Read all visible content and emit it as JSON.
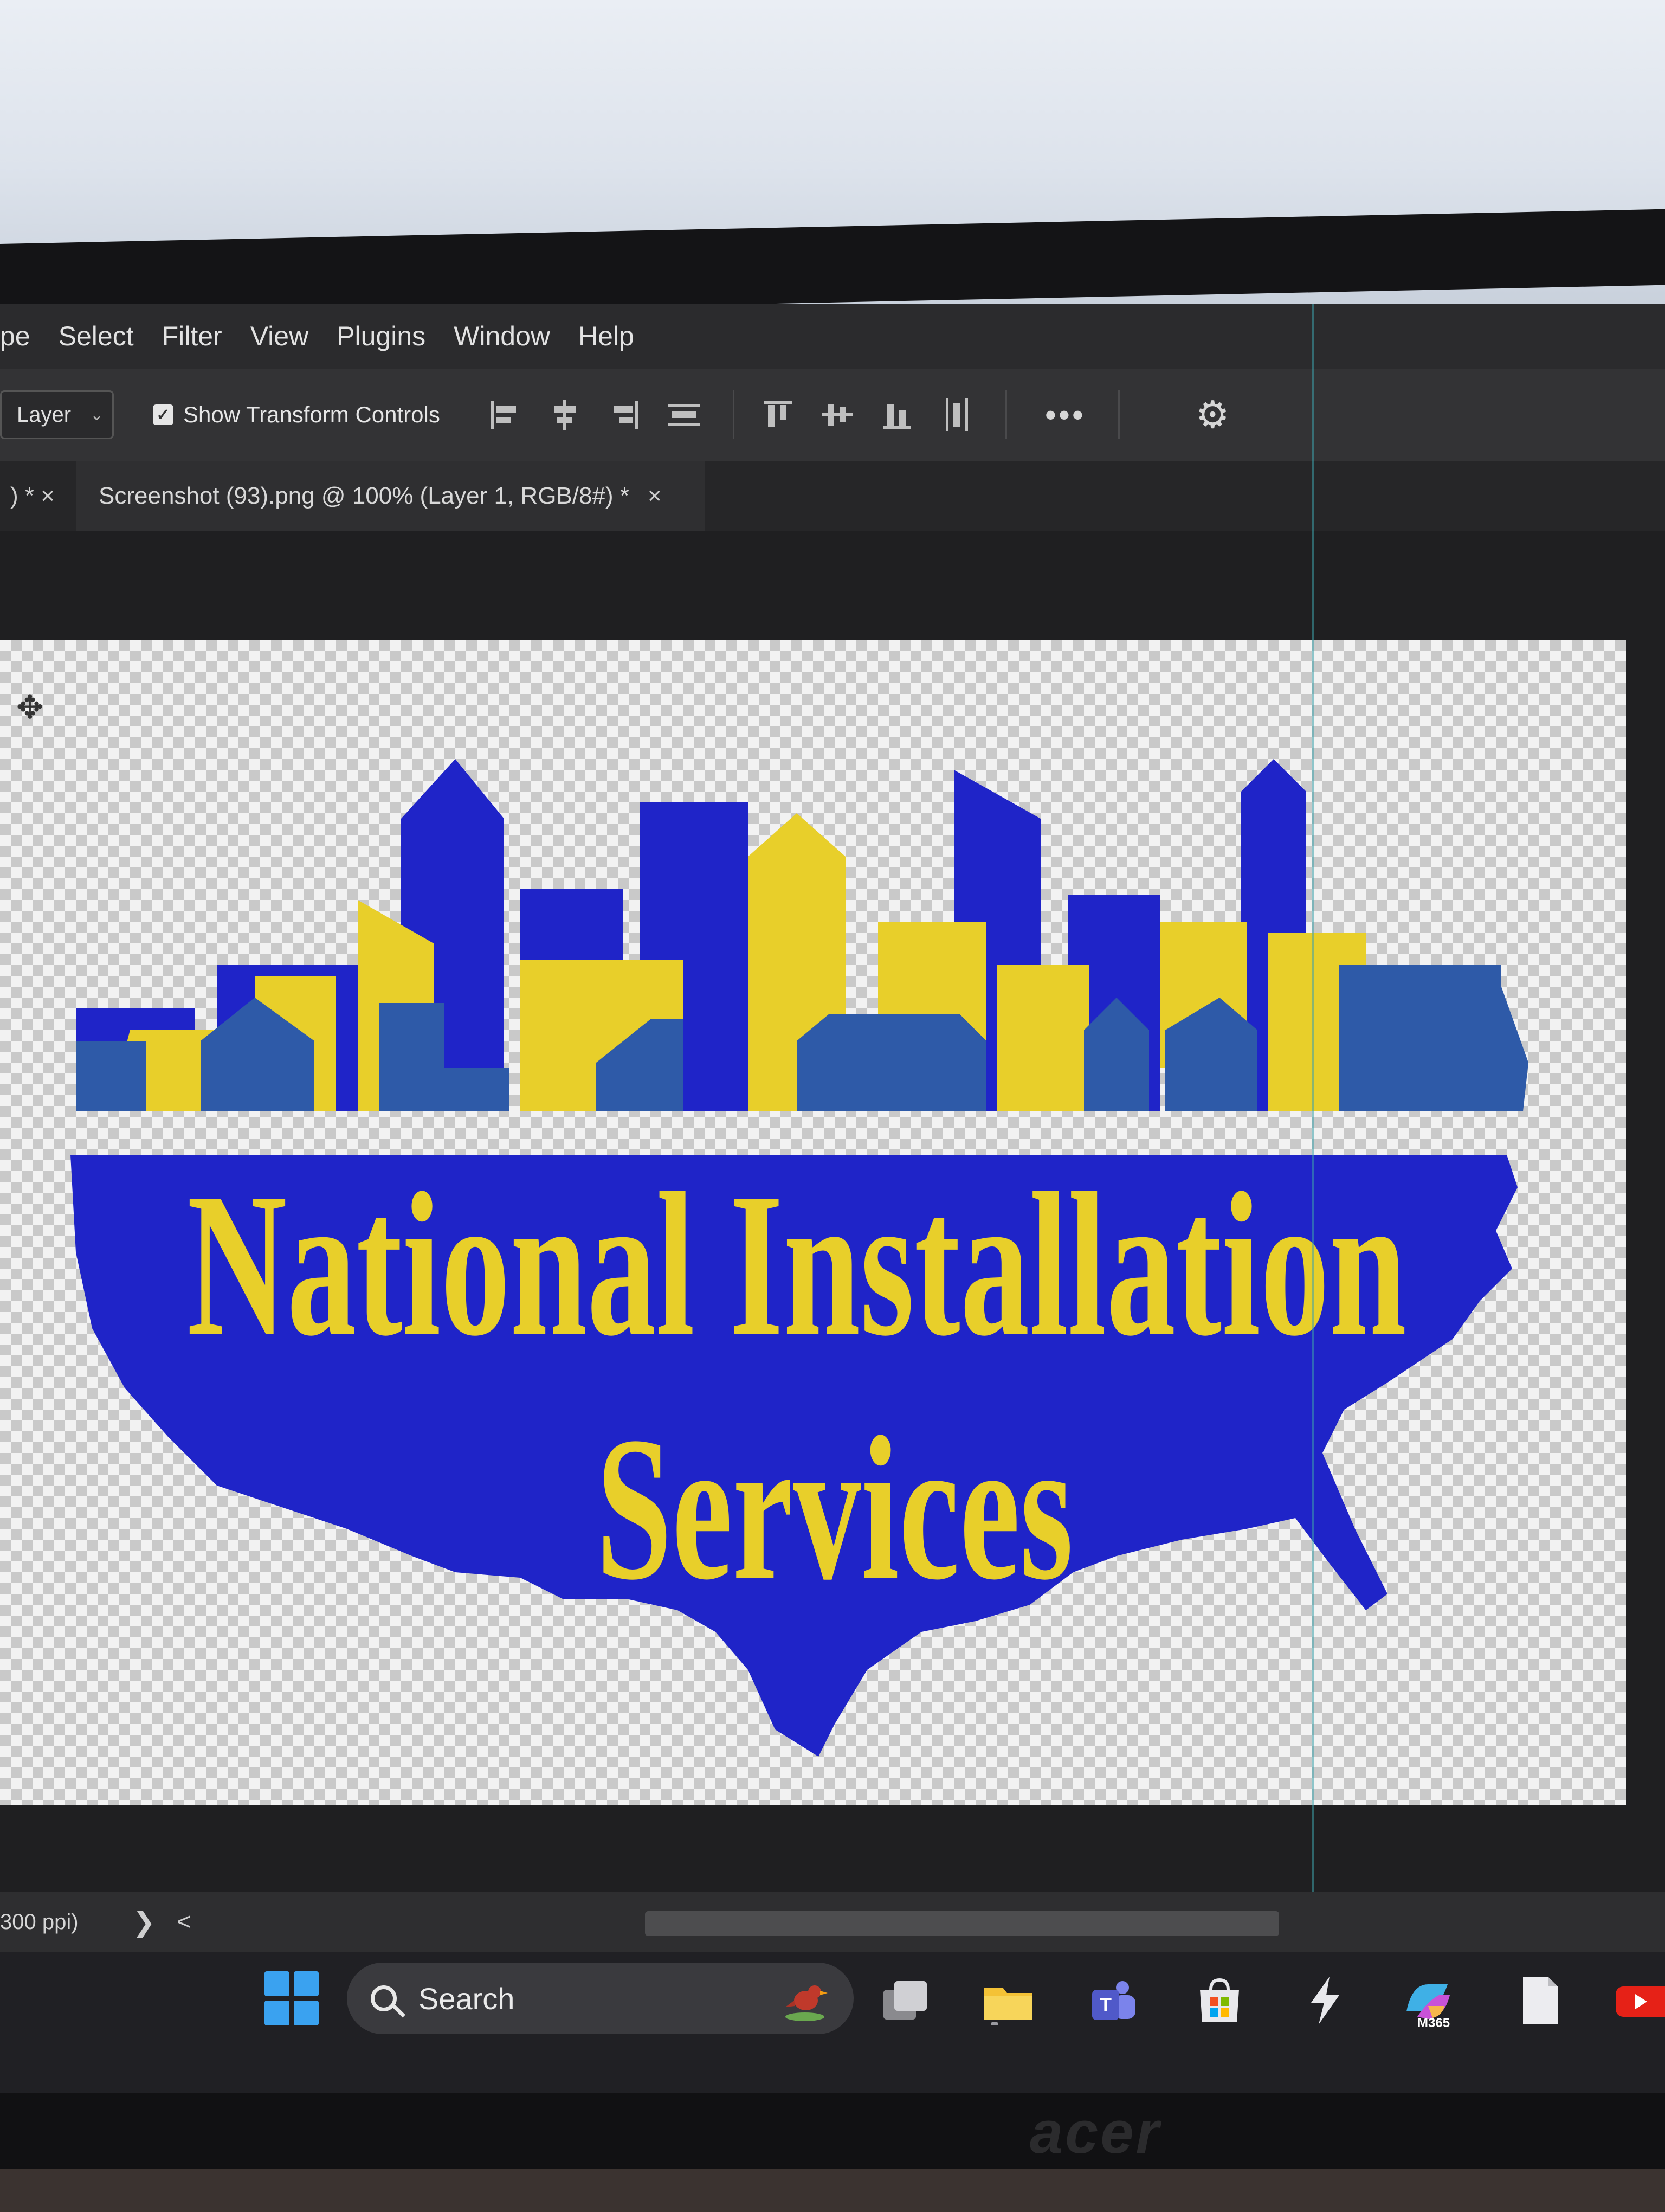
{
  "menubar": {
    "items": [
      "pe",
      "Select",
      "Filter",
      "View",
      "Plugins",
      "Window",
      "Help"
    ]
  },
  "options_bar": {
    "layer_select": "Layer",
    "show_transform_controls": "Show Transform Controls",
    "more_label": "•••"
  },
  "tabs": {
    "prev_tab": ") * ×",
    "active_tab": "Screenshot (93).png @ 100% (Layer 1, RGB/8#) *",
    "close_glyph": "×"
  },
  "artwork": {
    "line1": "National Installation",
    "line2": "Services",
    "colors": {
      "map_blue": "#1f24c8",
      "building_blue": "#2e5aa8",
      "yellow": "#e8cf2a"
    }
  },
  "status_bar": {
    "zoom_info": "300 ppi)",
    "arrow": "❯",
    "scroll_left": "<"
  },
  "taskbar": {
    "search_label": "Search",
    "m365_label": "M365"
  },
  "monitor": {
    "brand": "acer"
  }
}
